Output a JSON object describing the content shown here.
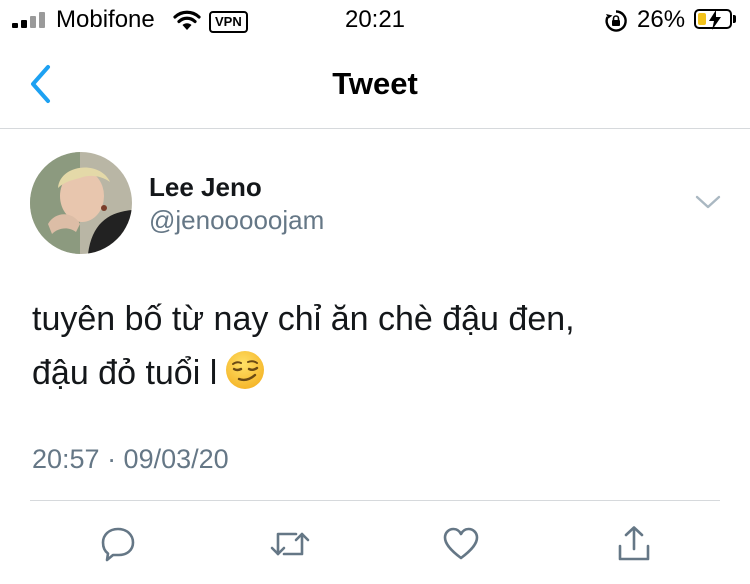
{
  "status_bar": {
    "carrier": "Mobifone",
    "vpn": "VPN",
    "time": "20:21",
    "battery_percent": "26%",
    "battery_level": 0.26,
    "icons": [
      "signal-icon",
      "wifi-icon",
      "orientation-lock-icon",
      "battery-charging-icon"
    ]
  },
  "header": {
    "title": "Tweet",
    "back_icon": "chevron-left-icon"
  },
  "tweet": {
    "author_name": "Lee Jeno",
    "author_handle": "@jenooooojam",
    "text_line1": "tuyên bố từ nay chỉ ăn chè đậu đen,",
    "text_line2": "đậu đỏ tuổi l",
    "emoji": "smirking-face-emoji",
    "timestamp": "20:57 · 09/03/20",
    "more_icon": "chevron-down-icon"
  },
  "actions": [
    {
      "name": "reply",
      "icon": "reply-icon"
    },
    {
      "name": "retweet",
      "icon": "retweet-icon"
    },
    {
      "name": "like",
      "icon": "heart-icon"
    },
    {
      "name": "share",
      "icon": "share-icon"
    }
  ],
  "colors": {
    "accent": "#1da1f2",
    "secondary_text": "#657786",
    "icon_gray": "#657786",
    "divider": "#d6d9dc"
  }
}
